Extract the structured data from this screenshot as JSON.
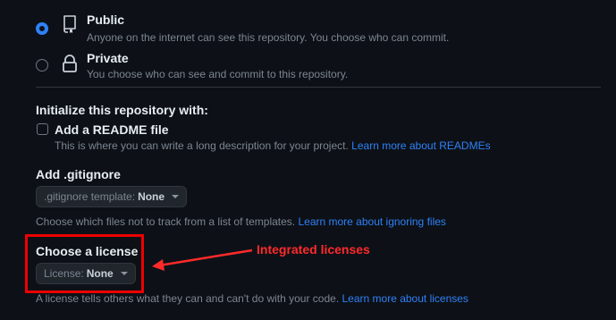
{
  "visibility": {
    "public": {
      "title": "Public",
      "description": "Anyone on the internet can see this repository. You choose who can commit.",
      "selected": true
    },
    "private": {
      "title": "Private",
      "description": "You choose who can see and commit to this repository.",
      "selected": false
    }
  },
  "initialize": {
    "heading": "Initialize this repository with:",
    "readme": {
      "label": "Add a README file",
      "description": "This is where you can write a long description for your project.",
      "link": "Learn more about READMEs",
      "checked": false
    }
  },
  "gitignore": {
    "heading": "Add .gitignore",
    "dropdown_prefix": ".gitignore template:",
    "dropdown_value": "None",
    "help": "Choose which files not to track from a list of templates.",
    "link": "Learn more about ignoring files"
  },
  "license": {
    "heading": "Choose a license",
    "dropdown_prefix": "License:",
    "dropdown_value": "None",
    "help": "A license tells others what they can and can't do with your code.",
    "link": "Learn more about licenses"
  },
  "annotation": {
    "text": "Integrated licenses",
    "color": "#ff2a2a"
  },
  "colors": {
    "background": "#0d1117",
    "accent": "#2f81f7",
    "highlight": "#e00000"
  }
}
